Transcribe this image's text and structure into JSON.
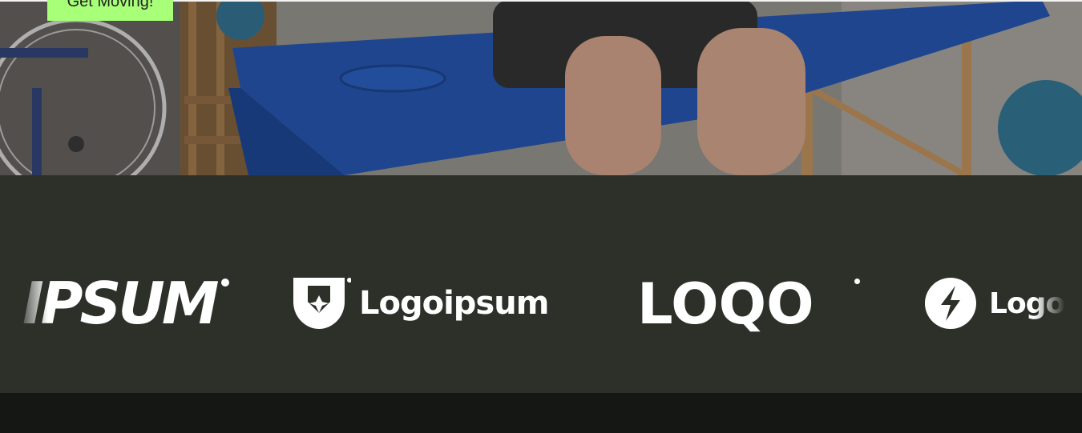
{
  "hero": {
    "cta_label": "Get Moving!",
    "image_alt": "patient-on-therapy-table"
  },
  "logos": {
    "items": [
      {
        "text": "IPSUM"
      },
      {
        "text": "Logoipsum"
      },
      {
        "text": "LOQO"
      },
      {
        "text": "Logoi"
      }
    ]
  },
  "colors": {
    "cta_bg": "#a8ff78",
    "band_bg": "#2c3029",
    "footer_bg": "#141714",
    "table_blue": "#1f4fa8"
  }
}
